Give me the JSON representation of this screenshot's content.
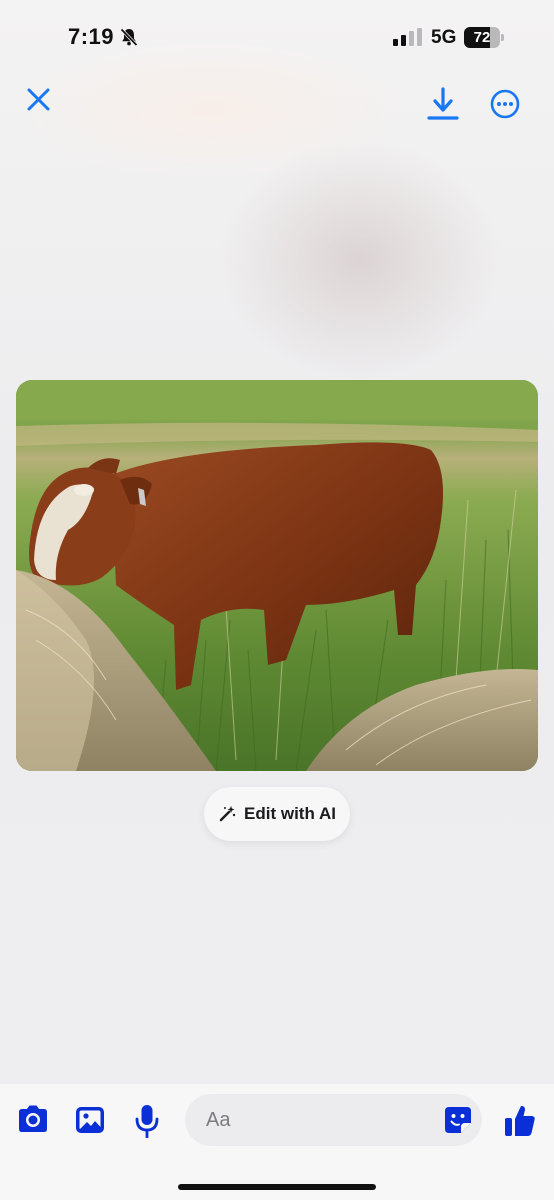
{
  "status_bar": {
    "time": "7:19",
    "network": "5G",
    "battery": "72",
    "battery_level": 0.72,
    "icons": [
      "bell-slash-icon",
      "signal-bars-icon"
    ]
  },
  "top_bar": {
    "icons": [
      "close-icon",
      "download-icon",
      "more-options-icon"
    ],
    "accent_color": "#1877f2"
  },
  "photo": {
    "subject": "photo-cow-in-grass"
  },
  "ai_button": {
    "label": "Edit with AI",
    "icon": "magic-wand-icon"
  },
  "composer": {
    "placeholder": "Aa",
    "icons": [
      "camera-icon",
      "image-icon",
      "microphone-icon",
      "sticker-icon",
      "thumbs-up-icon"
    ],
    "icon_color": "#0a2fd6"
  }
}
